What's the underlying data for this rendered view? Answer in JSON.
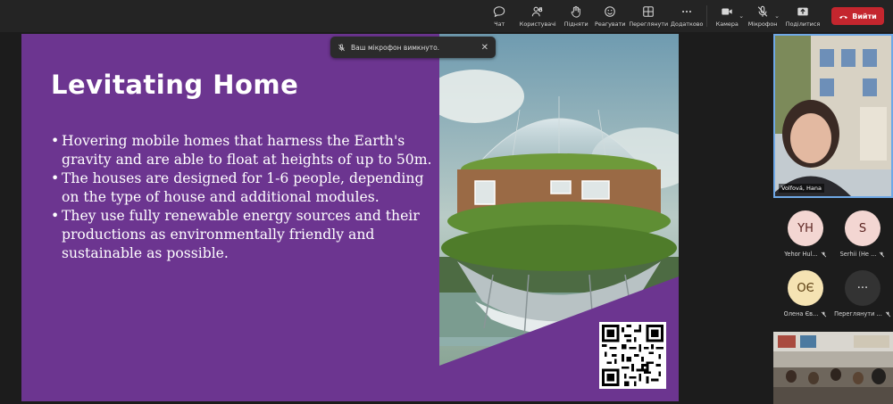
{
  "toolbar": {
    "chat": "Чат",
    "participants": "Користувачі",
    "participants_count": "8",
    "raise": "Підняти",
    "react": "Реагувати",
    "view": "Переглянути",
    "more": "Додатково",
    "camera": "Камера",
    "mic": "Мікрофон",
    "share": "Поділитися",
    "leave": "Вийти"
  },
  "toast": {
    "text": "Ваш мікрофон вимкнуто."
  },
  "slide": {
    "title": "Levitating Home",
    "bullets": [
      "Hovering mobile homes that harness the Earth's gravity and are able to float at heights of up to 50m.",
      "The houses are designed for 1-6 people, depending on the type of house and additional modules.",
      "They use fully renewable energy sources and their productions as environmentally friendly and sustainable as possible."
    ],
    "accent": "#6c3590"
  },
  "participants": {
    "self": {
      "name": "Volfová, Hana"
    },
    "tiles": [
      {
        "initials": "YH",
        "name": "Yehor Hul...",
        "bg": "#f3d6d2",
        "fg": "#5b2320"
      },
      {
        "initials": "S",
        "name": "Serhii (He ...",
        "bg": "#f3d6d2",
        "fg": "#5b2320"
      },
      {
        "initials": "ОЄ",
        "name": "Олена Єв...",
        "bg": "#f5e3b3",
        "fg": "#5a3d10"
      },
      {
        "initials": "···",
        "name": "Переглянути ...",
        "bg": "#333333",
        "fg": "#e6e6e6"
      }
    ]
  },
  "colors": {
    "leave": "#c4262e",
    "self_border": "#6fa8e6"
  }
}
